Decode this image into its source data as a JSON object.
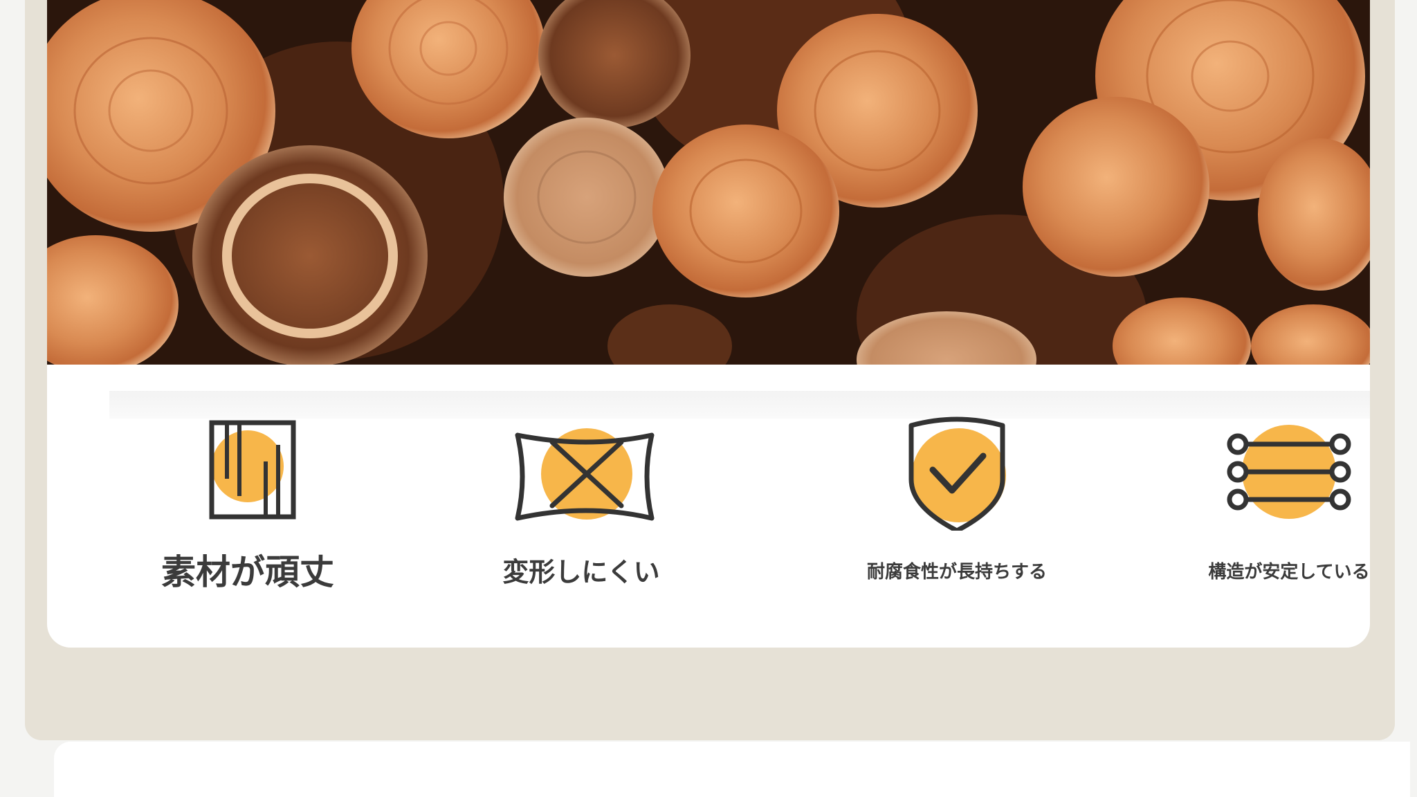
{
  "hero": {
    "icon": "stacked-logs-photo"
  },
  "features": [
    {
      "label": "素材が頑丈",
      "icon": "wood-grain-icon"
    },
    {
      "label": "変形しにくい",
      "icon": "no-warp-icon"
    },
    {
      "label": "耐腐食性が長持ちする",
      "icon": "shield-check-icon"
    },
    {
      "label": "構造が安定している",
      "icon": "structure-lines-icon"
    }
  ],
  "colors": {
    "accent": "#f7b64a",
    "icon_stroke": "#333333",
    "text": "#3b3b3b",
    "outer_card": "#e6e1d6"
  }
}
